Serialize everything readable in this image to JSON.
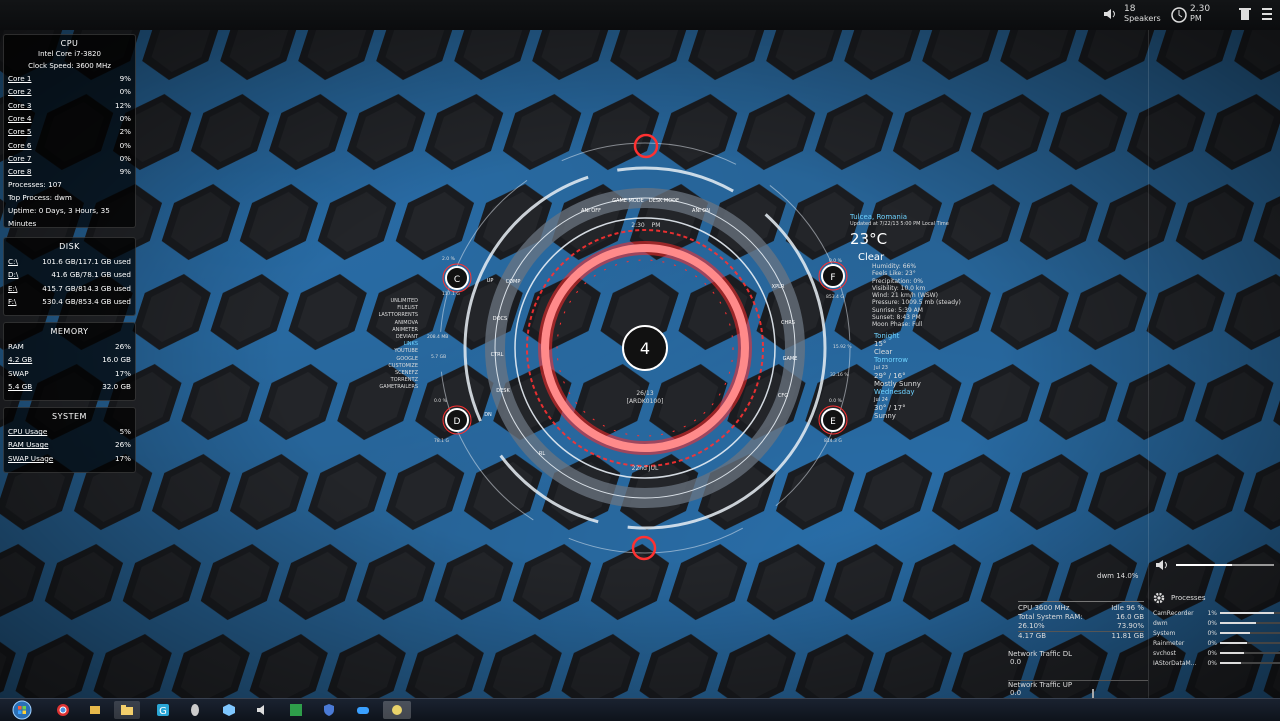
{
  "topbar": {
    "volume_level": "18",
    "volume_label": "Speakers",
    "clock_time": "2.30",
    "clock_ampm": "PM",
    "icons": [
      "speaker-icon",
      "clock-icon",
      "trash-icon",
      "menu-icon"
    ]
  },
  "cpu": {
    "title": "CPU",
    "model": "Intel Core i7-3820",
    "clock": "Clock Speed: 3600 MHz",
    "cores": [
      {
        "label": "Core 1",
        "value": "9%"
      },
      {
        "label": "Core 2",
        "value": "0%"
      },
      {
        "label": "Core 3",
        "value": "12%"
      },
      {
        "label": "Core 4",
        "value": "0%"
      },
      {
        "label": "Core 5",
        "value": "2%"
      },
      {
        "label": "Core 6",
        "value": "0%"
      },
      {
        "label": "Core 7",
        "value": "0%"
      },
      {
        "label": "Core 8",
        "value": "9%"
      }
    ],
    "processes": "Processes: 107",
    "top_process": "Top Process: dwm",
    "uptime": "Uptime: 0 Days, 3 Hours, 35 Minutes"
  },
  "disk": {
    "title": "DISK",
    "drives": [
      {
        "label": "C:\\",
        "value": "101.6 GB/117.1 GB used"
      },
      {
        "label": "D:\\",
        "value": "41.6 GB/78.1 GB used"
      },
      {
        "label": "E:\\",
        "value": "415.7 GB/814.3 GB used"
      },
      {
        "label": "F:\\",
        "value": "530.4 GB/853.4 GB used"
      }
    ]
  },
  "memory": {
    "title": "MEMORY",
    "rows": [
      {
        "label": "RAM",
        "value": "26%"
      },
      {
        "label": "4.2 GB",
        "value": "16.0 GB"
      },
      {
        "label": "SWAP",
        "value": "17%"
      },
      {
        "label": "5.4 GB",
        "value": "32.0 GB"
      }
    ]
  },
  "system": {
    "title": "SYSTEM",
    "rows": [
      {
        "label": "CPU Usage",
        "value": "5%"
      },
      {
        "label": "RAM Usage",
        "value": "26%"
      },
      {
        "label": "SWAP Usage",
        "value": "17%"
      }
    ]
  },
  "hud": {
    "center_number": "4",
    "date": "26/13",
    "user": "[ARDK0100]",
    "month": "22nd JUL",
    "ring_labels": [
      "ANI OFF",
      "GAME MODE",
      "DESK MODE",
      "ANI ON",
      "XPLR",
      "CHRS",
      "GAME",
      "CFG",
      "DOCS",
      "CTRL",
      "DESK",
      "RL",
      "COMP",
      "UP",
      "DN"
    ],
    "left_links": [
      "UNLIMITED",
      "FILELIST",
      "LASTTORRENTS",
      "ANIMOVA",
      "ANIMETER",
      "DEVIANT",
      "LINKS",
      "YOUTUBE",
      "GOOGLE",
      "CUSTOMIZE",
      "SCENEFZ",
      "TORRENTZ",
      "GAMETRAILERS"
    ],
    "drives": [
      {
        "letter": "C",
        "used": "2.0 %",
        "size": "117.1 G"
      },
      {
        "letter": "D",
        "used": "0.0 %",
        "size": "78.1 G"
      },
      {
        "letter": "E",
        "used": "0.0 %",
        "size": "814.3 G"
      },
      {
        "letter": "F",
        "used": "0.0 %",
        "size": "853.4 G"
      }
    ],
    "side_values": [
      "208.4 MB",
      "5.7 GB",
      "15.92 %",
      "32.16 %"
    ],
    "time_top": "2:30",
    "ampm_top": "PM"
  },
  "weather": {
    "location": "Tulcea, Romania",
    "updated": "Updated at 7/22/13 5:00 PM Local Time",
    "temp": "23°C",
    "condition": "Clear",
    "details": [
      "Humidity: 66%",
      "Feels Like: 23°",
      "Precipitation: 0%",
      "Visibility: 10.0 km",
      "Wind: 21 km/h (WSW)",
      "Pressure: 1009.5 mb (steady)",
      "Sunrise: 5:39 AM",
      "Sunset: 8:43 PM",
      "Moon Phase: Full"
    ],
    "forecast": [
      {
        "day": "Tonight",
        "temp": "15°",
        "cond": "Clear"
      },
      {
        "day": "Tomorrow",
        "date": "Jul 23",
        "temp": "29° / 16°",
        "cond": "Mostly Sunny"
      },
      {
        "day": "Wednesday",
        "date": "Jul 24",
        "temp": "30° / 17°",
        "cond": "Sunny"
      }
    ]
  },
  "dwm_text": "dwm 14.0%",
  "perf": {
    "cpu": "CPU 3600 MHz",
    "idle": "Idle 96 %",
    "ram_label": "Total System RAM:",
    "ram_total": "16.0 GB",
    "pct_used": "26.10%",
    "pct_free": "73.90%",
    "used": "4.17 GB",
    "free": "11.81 GB"
  },
  "network": {
    "dl_label": "Network Traffic DL",
    "dl_value": "0.0",
    "up_label": "Network Traffic UP",
    "up_value": "0.0"
  },
  "processes": {
    "title": "Processes",
    "items": [
      {
        "name": "CamRecorder",
        "pct": "1%",
        "fraction": 0.9
      },
      {
        "name": "dwm",
        "pct": "0%",
        "fraction": 0.6
      },
      {
        "name": "System",
        "pct": "0%",
        "fraction": 0.5
      },
      {
        "name": "Rainmeter",
        "pct": "0%",
        "fraction": 0.45
      },
      {
        "name": "svchost",
        "pct": "0%",
        "fraction": 0.4
      },
      {
        "name": "IAStorDataM...",
        "pct": "0%",
        "fraction": 0.35
      }
    ]
  },
  "taskbar": {
    "apps": [
      "start-orb-icon",
      "chrome-icon",
      "explorer-icon",
      "folder-icon",
      "app-g-icon",
      "app-mouse-icon",
      "app-cube-icon",
      "app-speaker-icon",
      "app-excel-icon",
      "app-shield-icon",
      "app-gamepad-icon",
      "app-paint-icon"
    ]
  },
  "colors": {
    "accent": "#2f9dff",
    "hud_red": "#ff3131",
    "panel_bg": "#000000"
  }
}
